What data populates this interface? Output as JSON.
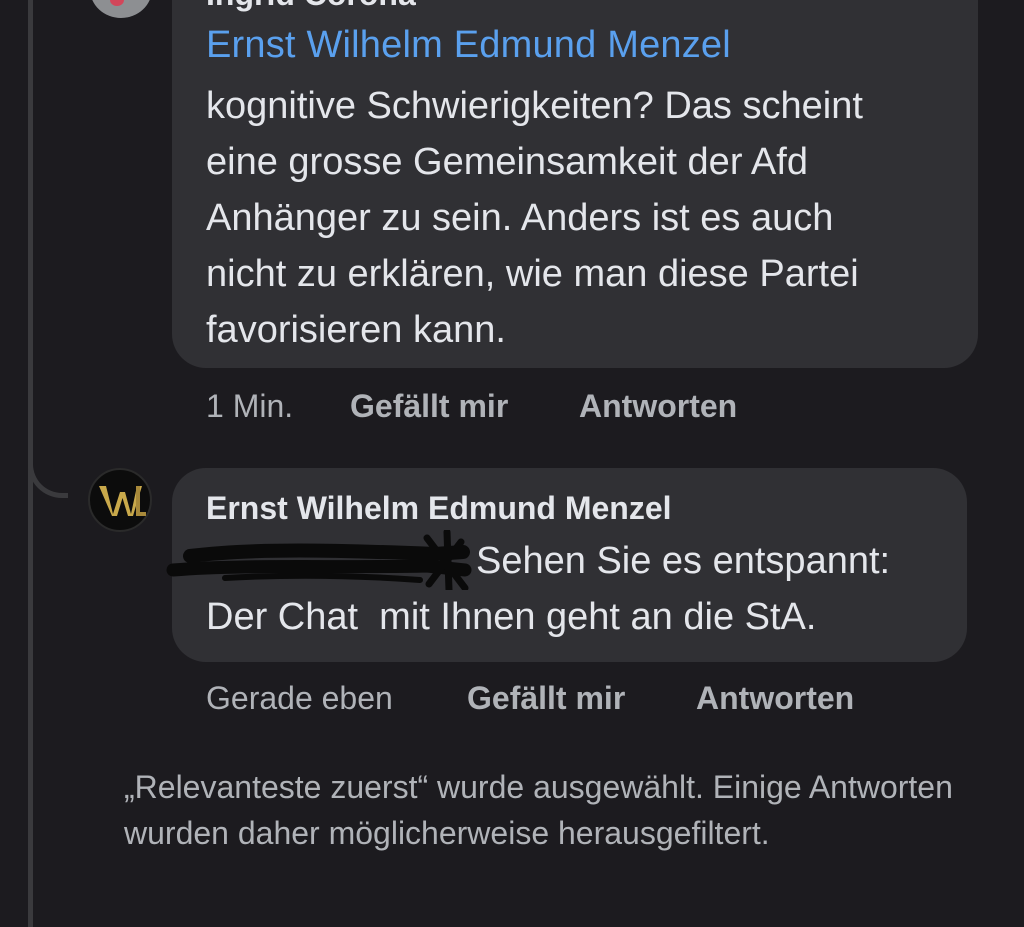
{
  "top_comment": {
    "author_cut": "Ingrid Corona",
    "mention": "Ernst Wilhelm Edmund Menzel",
    "text": "kognitive Schwierigkeiten? Das scheint\neine grosse Gemeinsamkeit der Afd\nAnhänger zu sein. Anders ist es auch\nnicht zu erklären, wie man diese Partei\nfavorisieren kann.",
    "time": "1 Min.",
    "like_label": "Gefällt mir",
    "reply_label": "Antworten"
  },
  "reply_comment": {
    "author": "Ernst Wilhelm Edmund Menzel",
    "text_line1": "Sehen Sie es entspannt:",
    "text_line2": "Der Chat  mit Ihnen geht an die StA.",
    "time": "Gerade eben",
    "like_label": "Gefällt mir",
    "reply_label": "Antworten",
    "avatar_icon": "w-logo-icon"
  },
  "notice": "„Relevanteste zuerst“ wurde ausgewählt. Einige Antworten wurden daher möglicherweise herausgefiltert.",
  "colors": {
    "background": "#1c1b1f",
    "bubble": "#303034",
    "mention": "#5aa0ee",
    "meta": "#b0b3b8",
    "avatar_gold": "#c9a94b"
  }
}
